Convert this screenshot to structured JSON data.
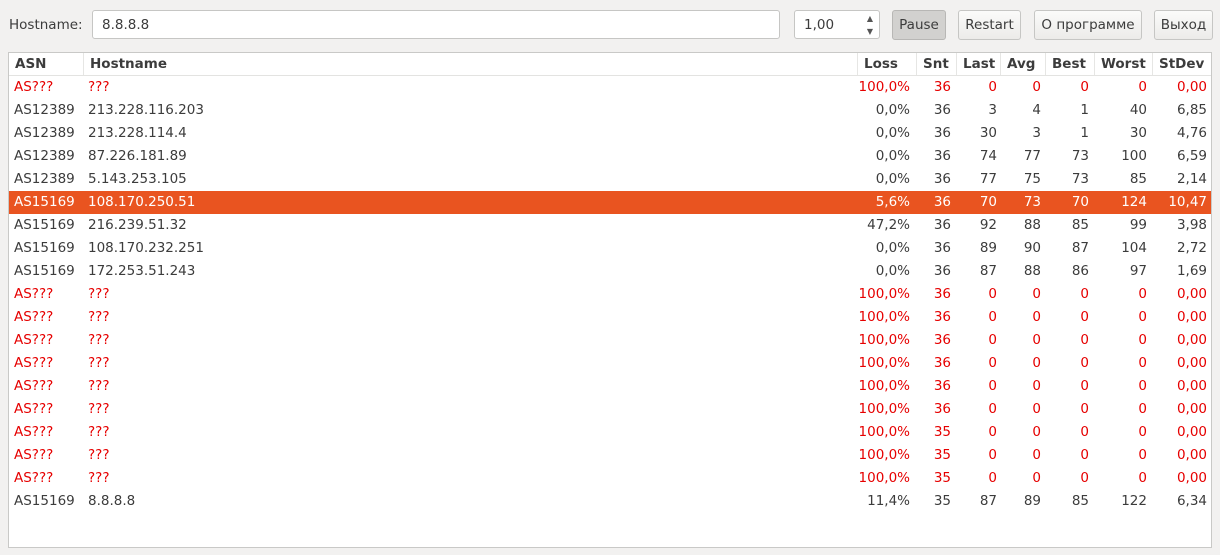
{
  "toolbar": {
    "hostname_label": "Hostname:",
    "hostname_value": "8.8.8.8",
    "interval_value": "1,00",
    "pause_label": "Pause",
    "restart_label": "Restart",
    "about_label": "О программе",
    "exit_label": "Выход"
  },
  "colors": {
    "accent": "#e95420",
    "unreachable": "#e60000"
  },
  "table": {
    "columns": [
      "ASN",
      "Hostname",
      "Loss",
      "Snt",
      "Last",
      "Avg",
      "Best",
      "Worst",
      "StDev"
    ],
    "rows": [
      {
        "asn": "AS???",
        "host": "???",
        "loss": "100,0%",
        "snt": "36",
        "last": "0",
        "avg": "0",
        "best": "0",
        "worst": "0",
        "stdev": "0,00",
        "state": "red"
      },
      {
        "asn": "AS12389",
        "host": "213.228.116.203",
        "loss": "0,0%",
        "snt": "36",
        "last": "3",
        "avg": "4",
        "best": "1",
        "worst": "40",
        "stdev": "6,85",
        "state": "normal"
      },
      {
        "asn": "AS12389",
        "host": "213.228.114.4",
        "loss": "0,0%",
        "snt": "36",
        "last": "30",
        "avg": "3",
        "best": "1",
        "worst": "30",
        "stdev": "4,76",
        "state": "normal"
      },
      {
        "asn": "AS12389",
        "host": "87.226.181.89",
        "loss": "0,0%",
        "snt": "36",
        "last": "74",
        "avg": "77",
        "best": "73",
        "worst": "100",
        "stdev": "6,59",
        "state": "normal"
      },
      {
        "asn": "AS12389",
        "host": "5.143.253.105",
        "loss": "0,0%",
        "snt": "36",
        "last": "77",
        "avg": "75",
        "best": "73",
        "worst": "85",
        "stdev": "2,14",
        "state": "normal"
      },
      {
        "asn": "AS15169",
        "host": "108.170.250.51",
        "loss": "5,6%",
        "snt": "36",
        "last": "70",
        "avg": "73",
        "best": "70",
        "worst": "124",
        "stdev": "10,47",
        "state": "selected"
      },
      {
        "asn": "AS15169",
        "host": "216.239.51.32",
        "loss": "47,2%",
        "snt": "36",
        "last": "92",
        "avg": "88",
        "best": "85",
        "worst": "99",
        "stdev": "3,98",
        "state": "normal"
      },
      {
        "asn": "AS15169",
        "host": "108.170.232.251",
        "loss": "0,0%",
        "snt": "36",
        "last": "89",
        "avg": "90",
        "best": "87",
        "worst": "104",
        "stdev": "2,72",
        "state": "normal"
      },
      {
        "asn": "AS15169",
        "host": "172.253.51.243",
        "loss": "0,0%",
        "snt": "36",
        "last": "87",
        "avg": "88",
        "best": "86",
        "worst": "97",
        "stdev": "1,69",
        "state": "normal"
      },
      {
        "asn": "AS???",
        "host": "???",
        "loss": "100,0%",
        "snt": "36",
        "last": "0",
        "avg": "0",
        "best": "0",
        "worst": "0",
        "stdev": "0,00",
        "state": "red"
      },
      {
        "asn": "AS???",
        "host": "???",
        "loss": "100,0%",
        "snt": "36",
        "last": "0",
        "avg": "0",
        "best": "0",
        "worst": "0",
        "stdev": "0,00",
        "state": "red"
      },
      {
        "asn": "AS???",
        "host": "???",
        "loss": "100,0%",
        "snt": "36",
        "last": "0",
        "avg": "0",
        "best": "0",
        "worst": "0",
        "stdev": "0,00",
        "state": "red"
      },
      {
        "asn": "AS???",
        "host": "???",
        "loss": "100,0%",
        "snt": "36",
        "last": "0",
        "avg": "0",
        "best": "0",
        "worst": "0",
        "stdev": "0,00",
        "state": "red"
      },
      {
        "asn": "AS???",
        "host": "???",
        "loss": "100,0%",
        "snt": "36",
        "last": "0",
        "avg": "0",
        "best": "0",
        "worst": "0",
        "stdev": "0,00",
        "state": "red"
      },
      {
        "asn": "AS???",
        "host": "???",
        "loss": "100,0%",
        "snt": "36",
        "last": "0",
        "avg": "0",
        "best": "0",
        "worst": "0",
        "stdev": "0,00",
        "state": "red"
      },
      {
        "asn": "AS???",
        "host": "???",
        "loss": "100,0%",
        "snt": "35",
        "last": "0",
        "avg": "0",
        "best": "0",
        "worst": "0",
        "stdev": "0,00",
        "state": "red"
      },
      {
        "asn": "AS???",
        "host": "???",
        "loss": "100,0%",
        "snt": "35",
        "last": "0",
        "avg": "0",
        "best": "0",
        "worst": "0",
        "stdev": "0,00",
        "state": "red"
      },
      {
        "asn": "AS???",
        "host": "???",
        "loss": "100,0%",
        "snt": "35",
        "last": "0",
        "avg": "0",
        "best": "0",
        "worst": "0",
        "stdev": "0,00",
        "state": "red"
      },
      {
        "asn": "AS15169",
        "host": "8.8.8.8",
        "loss": "11,4%",
        "snt": "35",
        "last": "87",
        "avg": "89",
        "best": "85",
        "worst": "122",
        "stdev": "6,34",
        "state": "normal"
      }
    ]
  }
}
